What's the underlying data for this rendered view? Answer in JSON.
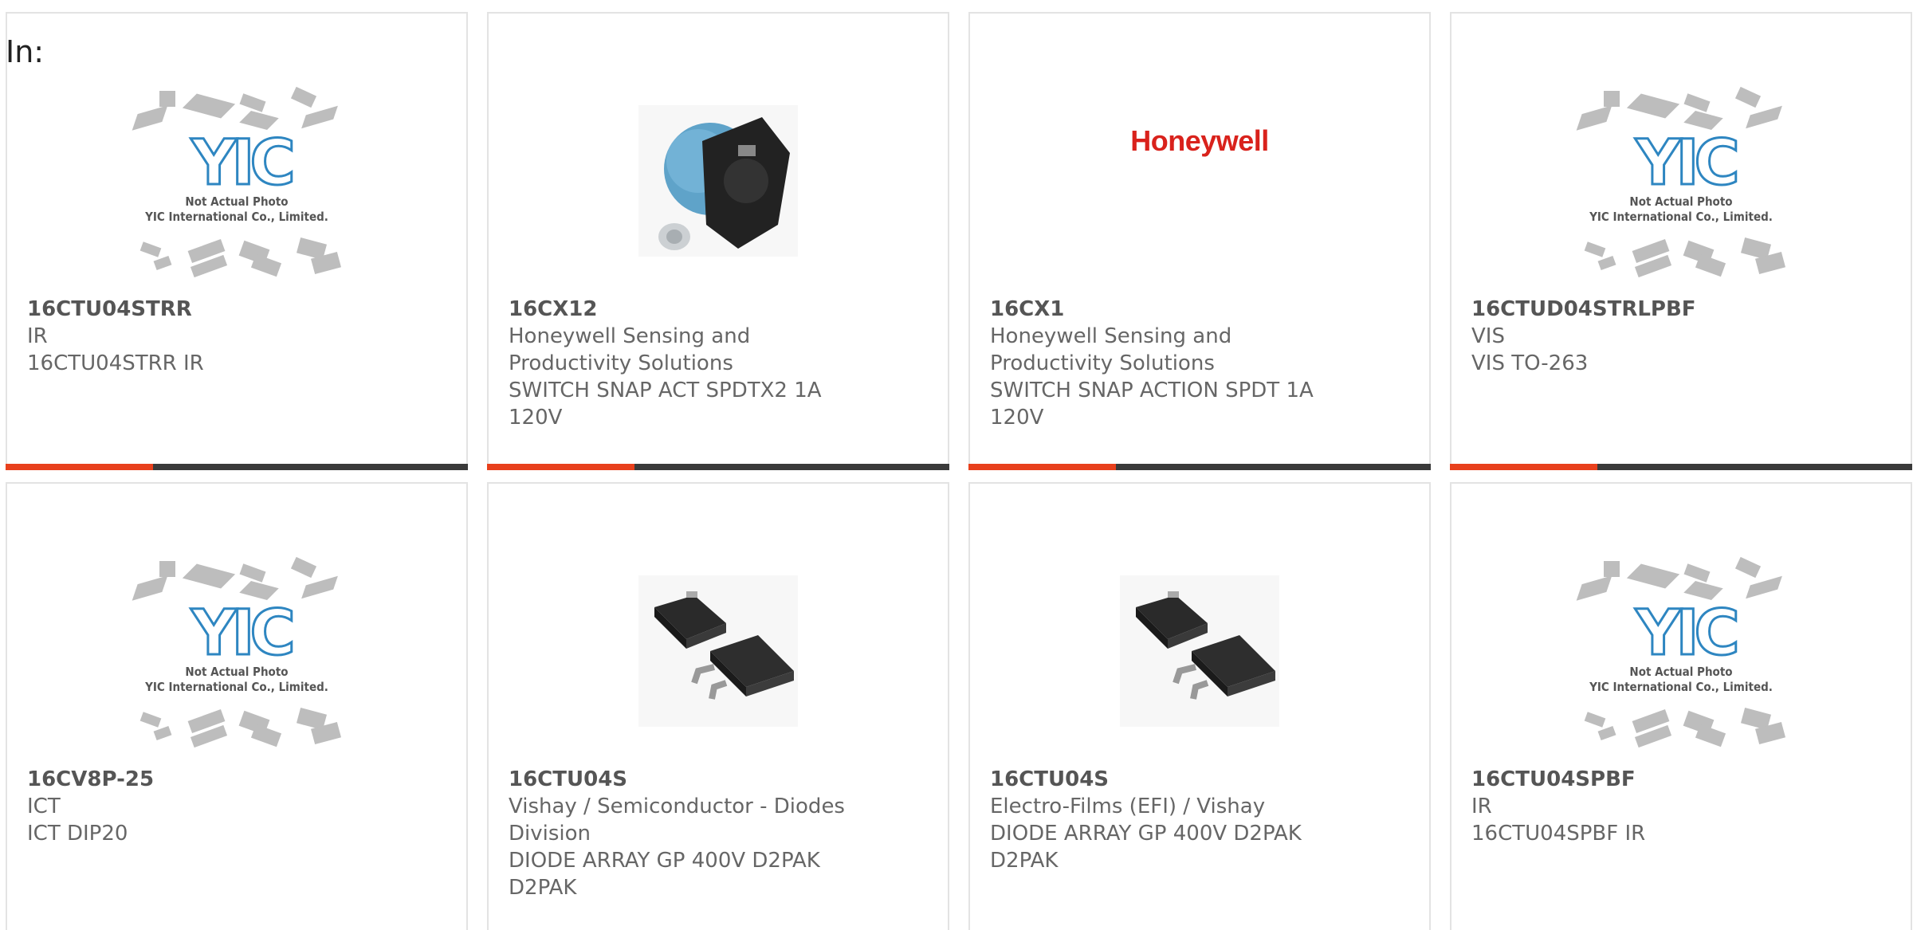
{
  "header": {
    "label": "In:"
  },
  "placeholder": {
    "brand": "YIC",
    "line1": "Not Actual Photo",
    "line2": "YIC International Co., Limited."
  },
  "colors": {
    "accent": "#e8401c",
    "bar": "#3a3a3a",
    "logo_red": "#d9221c",
    "yic_blue": "#2e86c1"
  },
  "products": [
    {
      "part": "16CTU04STRR",
      "maker": "IR",
      "desc": "16CTU04STRR IR",
      "image": "placeholder-icon"
    },
    {
      "part": "16CX12",
      "maker": "Honeywell Sensing and Productivity Solutions",
      "desc": "SWITCH SNAP ACT SPDTX2 1A 120V",
      "image": "switch-photo"
    },
    {
      "part": "16CX1",
      "maker": "Honeywell Sensing and Productivity Solutions",
      "desc": "SWITCH SNAP ACTION SPDT 1A 120V",
      "image": "honeywell-logo",
      "logo_text": "Honeywell"
    },
    {
      "part": "16CTUD04STRLPBF",
      "maker": "VIS",
      "desc": "VIS TO-263",
      "image": "placeholder-icon"
    },
    {
      "part": "16CV8P-25",
      "maker": "ICT",
      "desc": "ICT DIP20",
      "image": "placeholder-icon"
    },
    {
      "part": "16CTU04S",
      "maker": "Vishay / Semiconductor - Diodes Division",
      "desc": "DIODE ARRAY GP 400V D2PAK D2PAK",
      "image": "d2pak-photo"
    },
    {
      "part": "16CTU04S",
      "maker": "Electro-Films (EFI) / Vishay",
      "desc": "DIODE ARRAY GP 400V D2PAK D2PAK",
      "image": "d2pak-photo"
    },
    {
      "part": "16CTU04SPBF",
      "maker": "IR",
      "desc": "16CTU04SPBF IR",
      "image": "placeholder-icon"
    }
  ]
}
